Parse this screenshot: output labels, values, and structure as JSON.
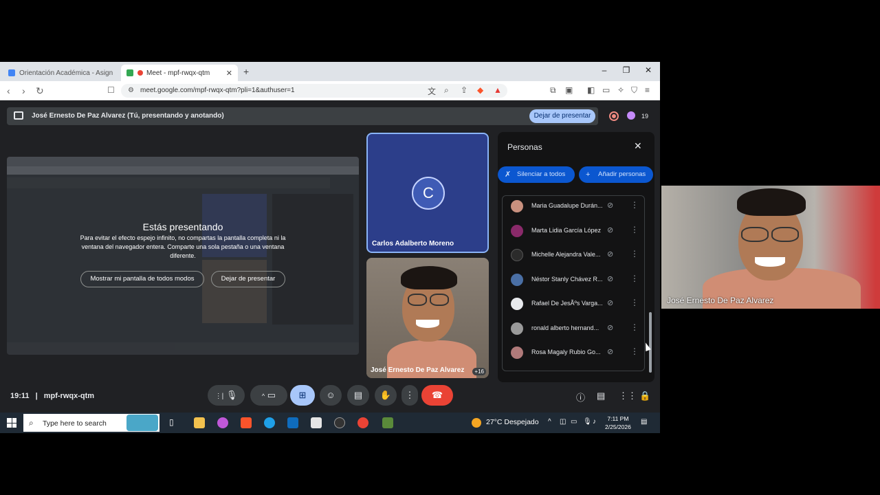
{
  "browser": {
    "tabs": [
      {
        "title": "Orientación Académica - Asignatura",
        "active": false
      },
      {
        "title": "Meet - mpf-rwqx-qtm",
        "active": true
      }
    ],
    "url": "meet.google.com/mpf-rwqx-qtm?pli=1&authuser=1"
  },
  "meet": {
    "presenting_bar": {
      "text": "José Ernesto De Paz Alvarez (Tú, presentando y anotando)",
      "stop_button": "Dejar de presentar",
      "participant_count": "19"
    },
    "presenting_panel": {
      "title": "Estás presentando",
      "message": "Para evitar el efecto espejo infinito, no compartas la pantalla completa ni la ventana del navegador entera. Comparte una sola pestaña o una ventana diferente.",
      "show_anyway_button": "Mostrar mi pantalla de todos modos",
      "stop_button": "Dejar de presentar"
    },
    "tiles": [
      {
        "name": "Carlos Adalberto Moreno",
        "initial": "C"
      },
      {
        "name": "José Ernesto De Paz Alvarez",
        "extra": "+16"
      }
    ],
    "people_panel": {
      "title": "Personas",
      "mute_all_button": "Silenciar a todos",
      "add_people_button": "Añadir personas",
      "participants": [
        {
          "name": "Maria Guadalupe Durán...",
          "color": "#c9917f"
        },
        {
          "name": "Marta Lidia García López",
          "color": "#8a2a6a"
        },
        {
          "name": "Michelle Alejandra Vale...",
          "color": "#2b2b2b"
        },
        {
          "name": "Néstor Stanly Chávez R...",
          "color": "#4a6fa5"
        },
        {
          "name": "Rafael De JesÃºs Varga...",
          "color": "#e8eaed"
        },
        {
          "name": "ronald alberto hernand...",
          "color": "#9a9a9a"
        },
        {
          "name": "Rosa Magaly Rubio Go...",
          "color": "#b07a7a"
        }
      ]
    },
    "bottom_bar": {
      "time": "19:11",
      "separator": "|",
      "meeting_code": "mpf-rwqx-qtm"
    }
  },
  "taskbar": {
    "search_placeholder": "Type here to search",
    "weather": "27°C  Despejado",
    "time": "7:11 PM",
    "date": "2/25/2026"
  },
  "webcam": {
    "name": "José Ernesto De Paz Alvarez"
  }
}
